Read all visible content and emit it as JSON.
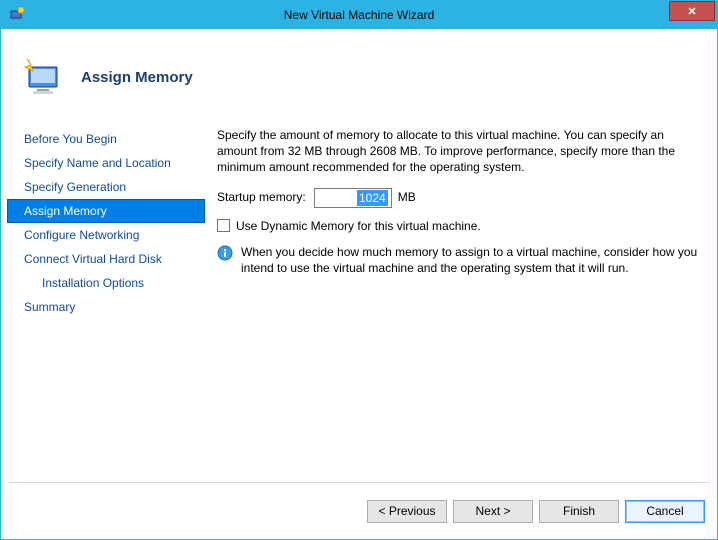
{
  "window": {
    "title": "New Virtual Machine Wizard"
  },
  "header": {
    "title": "Assign Memory"
  },
  "sidebar": {
    "items": [
      {
        "label": "Before You Begin"
      },
      {
        "label": "Specify Name and Location"
      },
      {
        "label": "Specify Generation"
      },
      {
        "label": "Assign Memory"
      },
      {
        "label": "Configure Networking"
      },
      {
        "label": "Connect Virtual Hard Disk"
      },
      {
        "label": "Installation Options"
      },
      {
        "label": "Summary"
      }
    ],
    "selected_index": 3
  },
  "content": {
    "description": "Specify the amount of memory to allocate to this virtual machine. You can specify an amount from 32 MB through 2608 MB. To improve performance, specify more than the minimum amount recommended for the operating system.",
    "startup_label": "Startup memory:",
    "startup_value": "1024",
    "startup_unit": "MB",
    "dynamic_label": "Use Dynamic Memory for this virtual machine.",
    "dynamic_checked": false,
    "info_text": "When you decide how much memory to assign to a virtual machine, consider how you intend to use the virtual machine and the operating system that it will run."
  },
  "footer": {
    "previous": "< Previous",
    "next": "Next >",
    "finish": "Finish",
    "cancel": "Cancel"
  }
}
